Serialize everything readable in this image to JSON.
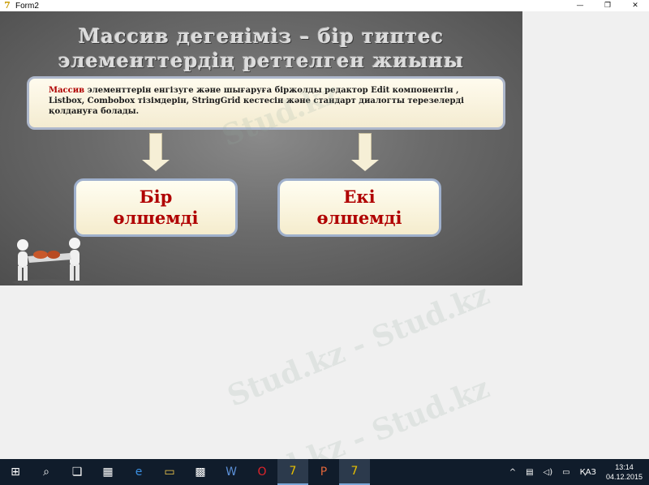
{
  "window": {
    "title": "Form2",
    "minimize_glyph": "—",
    "maximize_glyph": "❐",
    "close_glyph": "✕"
  },
  "slide": {
    "title_line1": "Массив дегеніміз – бір типтес",
    "title_line2": "элементтердің реттелген жиыны",
    "desc_keyword": "Массив",
    "desc_rest": " элементтерін енгізуге   және шығаруға біржолды   редактор Edit компонентін , Listbox, Combobox тізімдерін, StringGrid  кестесін және стандарт диалогты терезелерді қолдануға болады.",
    "box_one_line1": "Бір",
    "box_one_line2": "өлшемді",
    "box_two_line1": "Екі",
    "box_two_line2": "өлшемді"
  },
  "watermark": {
    "text1": "Stud.kz",
    "text2": "Stud.kz - Stud.kz",
    "text3": "Stud.kz - Stud.kz"
  },
  "taskbar": {
    "items": [
      {
        "name": "start-button",
        "glyph": "⊞"
      },
      {
        "name": "search-icon",
        "glyph": "⌕"
      },
      {
        "name": "task-view-icon",
        "glyph": "❏"
      },
      {
        "name": "store-icon",
        "glyph": "▦"
      },
      {
        "name": "edge-icon",
        "glyph": "e"
      },
      {
        "name": "file-explorer-icon",
        "glyph": "▭"
      },
      {
        "name": "calculator-icon",
        "glyph": "▩"
      },
      {
        "name": "word-icon",
        "glyph": "W"
      },
      {
        "name": "opera-icon",
        "glyph": "O"
      },
      {
        "name": "delphi-icon",
        "glyph": "7"
      },
      {
        "name": "powerpoint-icon",
        "glyph": "P"
      },
      {
        "name": "delphi2-icon",
        "glyph": "7"
      }
    ],
    "tray": {
      "chevron": "^",
      "language": "ҚАЗ",
      "time": "13:14",
      "date": "04.12.2015"
    }
  },
  "colors": {
    "keyword_red": "#b00000",
    "taskbar_bg": "#101c2b"
  }
}
